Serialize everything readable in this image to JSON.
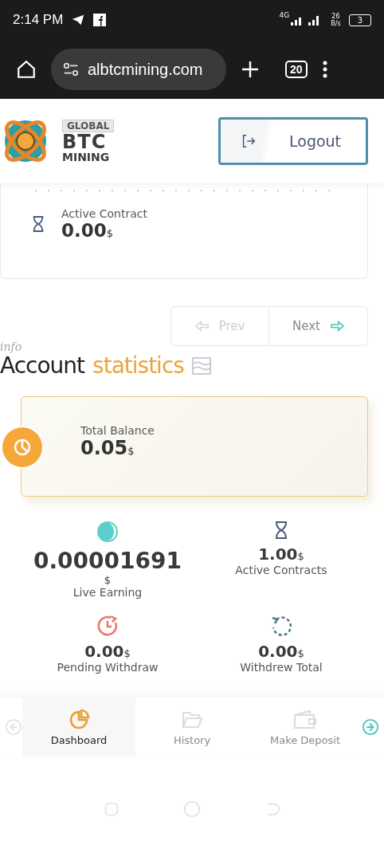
{
  "status_bar": {
    "time": "2:14 PM",
    "network": "4G",
    "speed": "26",
    "speed_unit": "B/s",
    "battery": "3"
  },
  "browser": {
    "url": "albtcmining.com",
    "tab_count": "20"
  },
  "header": {
    "logo": [
      "GLOBAL",
      "BTC",
      "MINING"
    ],
    "logout": "Logout"
  },
  "contract_card": {
    "label": "Active Contract",
    "value": "0.00",
    "unit": "$"
  },
  "pager": [
    {
      "label": "Prev",
      "disabled": true
    },
    {
      "label": "Next",
      "disabled": false
    }
  ],
  "section": {
    "tag": "info",
    "title_dark": "Account",
    "title_accent": "statistics"
  },
  "balance": {
    "label": "Total Balance",
    "value": "0.05",
    "unit": "$"
  },
  "stats": [
    {
      "kind": "pie",
      "value": "0.00001691",
      "unit": "$",
      "unit_below": true,
      "label": "Live Earning"
    },
    {
      "kind": "hourglass",
      "value": "1.00",
      "unit": "$",
      "unit_below": false,
      "label": "Active Contracts"
    },
    {
      "kind": "clock",
      "value": "0.00",
      "unit": "$",
      "unit_below": false,
      "label": "Pending Withdraw"
    },
    {
      "kind": "undo",
      "value": "0.00",
      "unit": "$",
      "unit_below": false,
      "label": "Withdrew Total"
    }
  ],
  "bottom_nav": [
    {
      "kind": "dashboard",
      "label": "Dashboard",
      "selected": true
    },
    {
      "kind": "folder",
      "label": "History",
      "selected": false
    },
    {
      "kind": "wallet",
      "label": "Make Deposit",
      "selected": false
    }
  ]
}
